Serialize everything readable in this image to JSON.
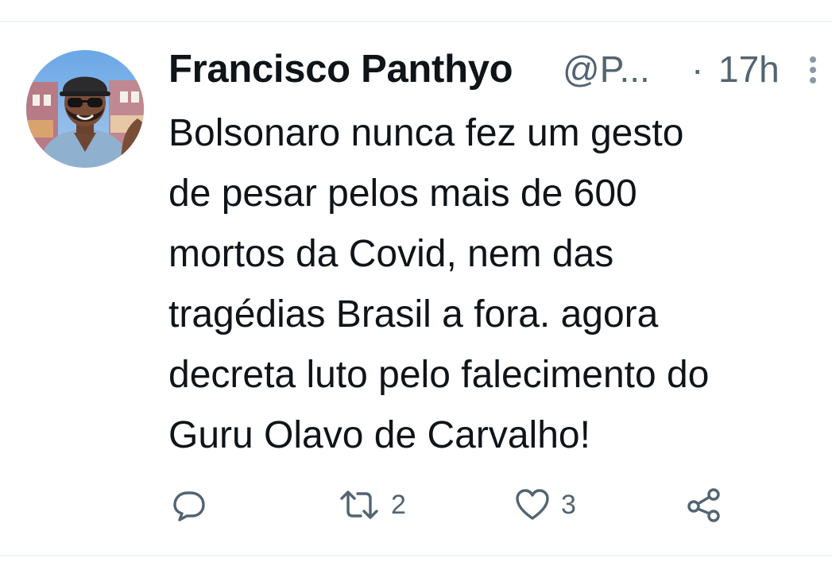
{
  "tweet": {
    "author": {
      "display_name": "Francisco Panthyo",
      "handle": "@P...",
      "avatar": "profile-photo"
    },
    "separator": "·",
    "time": "17h",
    "text_lines": [
      "Bolsonaro nunca fez um gesto",
      "de pesar pelos mais de 600",
      "mortos da Covid, nem das",
      "tragédias Brasil a fora. agora",
      "decreta luto pelo falecimento do",
      "Guru Olavo de Carvalho!"
    ]
  },
  "actions": {
    "reply": {
      "icon": "reply-icon",
      "count": ""
    },
    "retweet": {
      "icon": "retweet-icon",
      "count": "2"
    },
    "like": {
      "icon": "heart-icon",
      "count": "3"
    },
    "share": {
      "icon": "share-icon",
      "count": ""
    }
  },
  "colors": {
    "text_primary": "#0f1419",
    "text_secondary": "#536471",
    "divider": "#eff3f4",
    "background": "#ffffff"
  }
}
